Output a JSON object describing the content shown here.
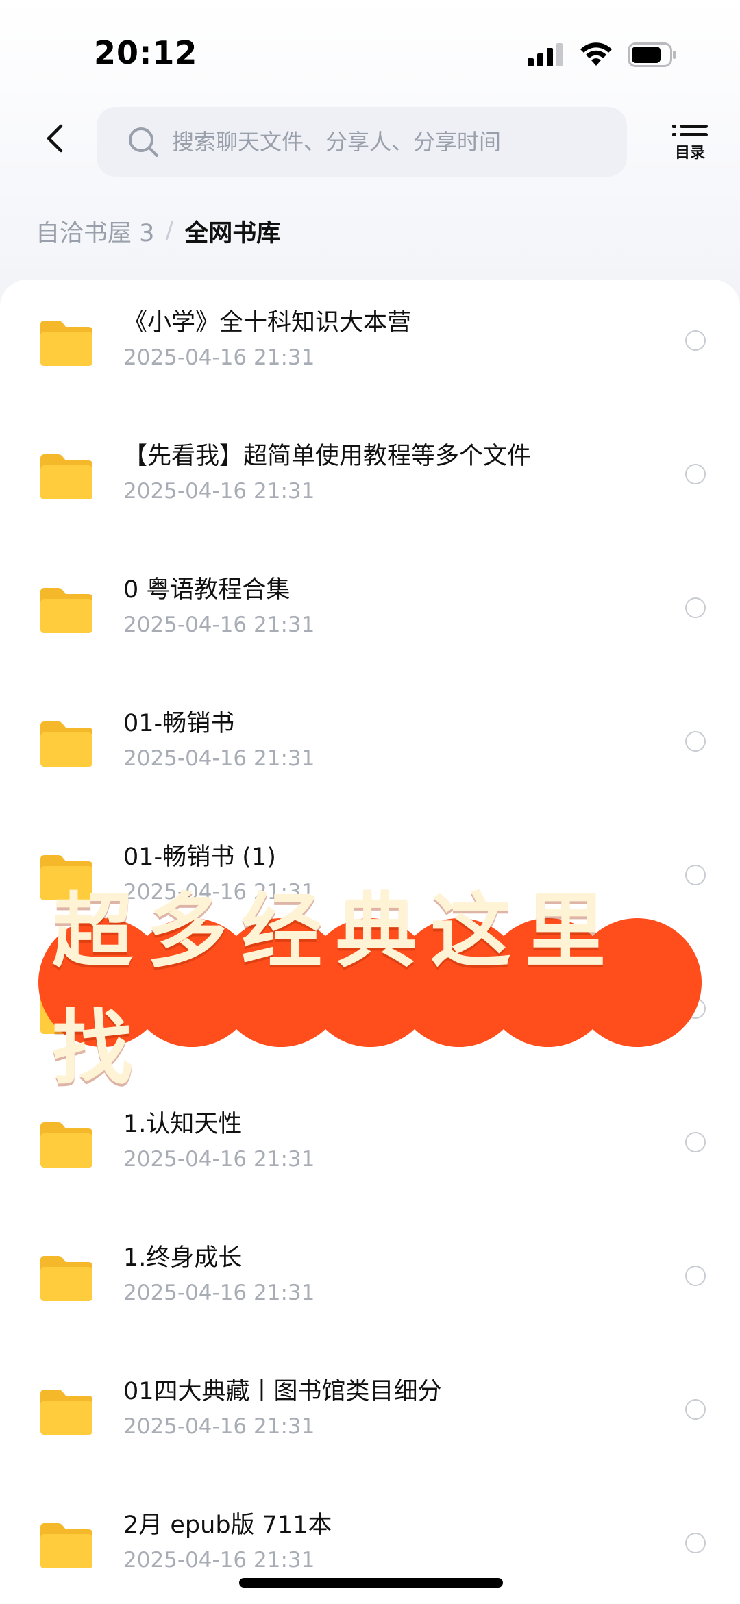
{
  "status_bar": {
    "time": "20:12"
  },
  "nav": {
    "search_placeholder": "搜索聊天文件、分享人、分享时间",
    "catalog_label": "目录"
  },
  "breadcrumb": {
    "parent": "自洽书屋 3",
    "separator": "/",
    "current": "全网书库"
  },
  "files": [
    {
      "name": "《小学》全十科知识大本营",
      "date": "2025-04-16 21:31"
    },
    {
      "name": "【先看我】超简单使用教程等多个文件",
      "date": "2025-04-16 21:31"
    },
    {
      "name": "0 粤语教程合集",
      "date": "2025-04-16 21:31"
    },
    {
      "name": "01-畅销书",
      "date": "2025-04-16 21:31"
    },
    {
      "name": "01-畅销书 (1)",
      "date": "2025-04-16 21:31"
    },
    {
      "name": "",
      "date": ""
    },
    {
      "name": "1.认知天性",
      "date": "2025-04-16 21:31"
    },
    {
      "name": "1.终身成长",
      "date": "2025-04-16 21:31"
    },
    {
      "name": "01四大典藏丨图书馆类目细分",
      "date": "2025-04-16 21:31"
    },
    {
      "name": "2月 epub版 711本",
      "date": "2025-04-16 21:31"
    }
  ],
  "promo": {
    "text": "超多经典这里找",
    "color": "#ff4d1c",
    "text_color": "#fff3d6"
  },
  "colors": {
    "folder": "#ffcc3e",
    "secondary_text": "#a7acb5"
  }
}
